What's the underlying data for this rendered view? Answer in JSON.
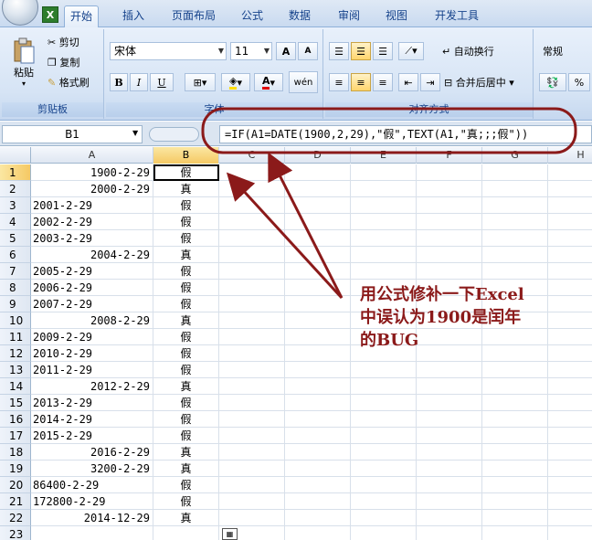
{
  "ribbon": {
    "tabs": [
      {
        "label": "开始"
      },
      {
        "label": "插入"
      },
      {
        "label": "页面布局"
      },
      {
        "label": "公式"
      },
      {
        "label": "数据"
      },
      {
        "label": "审阅"
      },
      {
        "label": "视图"
      },
      {
        "label": "开发工具"
      }
    ],
    "clipboard": {
      "paste": "粘贴",
      "cut": "剪切",
      "copy": "复制",
      "format_painter": "格式刷",
      "group_label": "剪贴板"
    },
    "font": {
      "name": "宋体",
      "size": "11",
      "grow": "A",
      "shrink": "A",
      "bold": "B",
      "italic": "I",
      "underline": "U",
      "wen": "wén",
      "group_label": "字体"
    },
    "alignment": {
      "wrap_text": "自动换行",
      "merge_center": "合并后居中",
      "group_label": "对齐方式"
    },
    "number": {
      "format": "常规",
      "percent": "%"
    }
  },
  "formula_bar": {
    "name_box": "B1",
    "formula": "=IF(A1=DATE(1900,2,29),\"假\",TEXT(A1,\"真;;;假\"))"
  },
  "grid": {
    "columns": [
      "A",
      "B",
      "C",
      "D",
      "E",
      "F",
      "G",
      "H"
    ],
    "rows": [
      {
        "n": "1",
        "a": "1900-2-29",
        "a_align": "right",
        "b": "假"
      },
      {
        "n": "2",
        "a": "2000-2-29",
        "a_align": "right",
        "b": "真"
      },
      {
        "n": "3",
        "a": "2001-2-29",
        "a_align": "left",
        "b": "假"
      },
      {
        "n": "4",
        "a": "2002-2-29",
        "a_align": "left",
        "b": "假"
      },
      {
        "n": "5",
        "a": "2003-2-29",
        "a_align": "left",
        "b": "假"
      },
      {
        "n": "6",
        "a": "2004-2-29",
        "a_align": "right",
        "b": "真"
      },
      {
        "n": "7",
        "a": "2005-2-29",
        "a_align": "left",
        "b": "假"
      },
      {
        "n": "8",
        "a": "2006-2-29",
        "a_align": "left",
        "b": "假"
      },
      {
        "n": "9",
        "a": "2007-2-29",
        "a_align": "left",
        "b": "假"
      },
      {
        "n": "10",
        "a": "2008-2-29",
        "a_align": "right",
        "b": "真"
      },
      {
        "n": "11",
        "a": "2009-2-29",
        "a_align": "left",
        "b": "假"
      },
      {
        "n": "12",
        "a": "2010-2-29",
        "a_align": "left",
        "b": "假"
      },
      {
        "n": "13",
        "a": "2011-2-29",
        "a_align": "left",
        "b": "假"
      },
      {
        "n": "14",
        "a": "2012-2-29",
        "a_align": "right",
        "b": "真"
      },
      {
        "n": "15",
        "a": "2013-2-29",
        "a_align": "left",
        "b": "假"
      },
      {
        "n": "16",
        "a": "2014-2-29",
        "a_align": "left",
        "b": "假"
      },
      {
        "n": "17",
        "a": "2015-2-29",
        "a_align": "left",
        "b": "假"
      },
      {
        "n": "18",
        "a": "2016-2-29",
        "a_align": "right",
        "b": "真"
      },
      {
        "n": "19",
        "a": "3200-2-29",
        "a_align": "right",
        "b": "真"
      },
      {
        "n": "20",
        "a": "86400-2-29",
        "a_align": "left",
        "b": "假"
      },
      {
        "n": "21",
        "a": "172800-2-29",
        "a_align": "left",
        "b": "假"
      },
      {
        "n": "22",
        "a": "2014-12-29",
        "a_align": "right",
        "b": "真"
      },
      {
        "n": "23",
        "a": "",
        "a_align": "left",
        "b": ""
      }
    ]
  },
  "annotation": {
    "text_line1": "用公式修补一下Excel",
    "text_line2": "中误认为1900是闰年",
    "text_line3": "的BUG",
    "color": "#8b1a1a"
  }
}
